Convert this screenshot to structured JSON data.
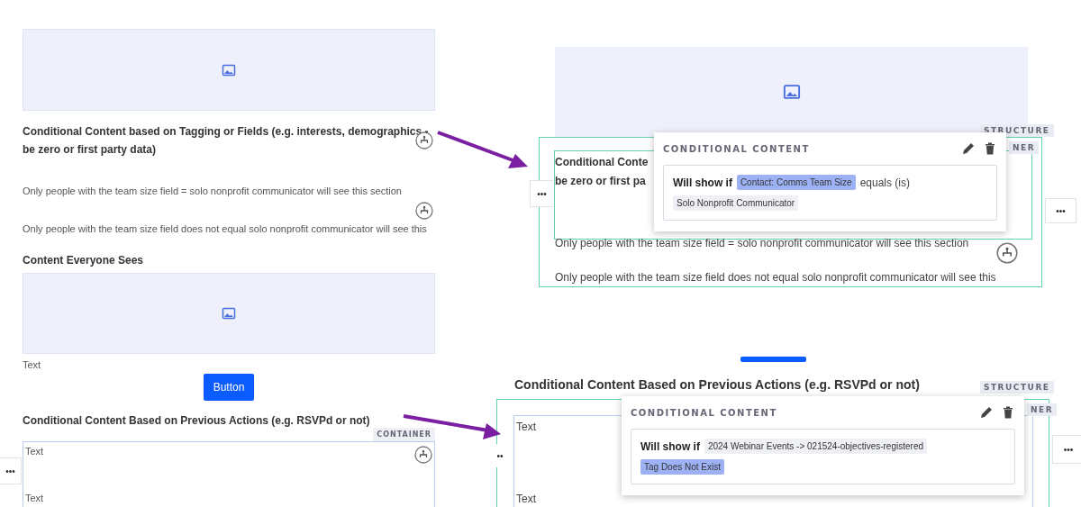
{
  "left_editor": {
    "tagging_heading_lines": [
      "Conditional Content based on Tagging or Fields (e.g. interests, demographics -",
      "be zero or first party data)"
    ],
    "field_equals_text": "Only people with the team size field = solo nonprofit communicator will see this section",
    "field_not_equal_text": "Only people with the team size field does not equal solo nonprofit communicator will see this",
    "everyone_heading": "Content Everyone Sees",
    "text_block": "Text",
    "button_label": "Button",
    "actions_heading": "Conditional Content Based on Previous Actions (e.g. RSVPd or not)",
    "container_tag": "CONTAINER",
    "container_texts": [
      "Text",
      "Text"
    ],
    "more_button": "•••"
  },
  "fields_popup_view": {
    "structure_tag": "STRUCTURE",
    "container_tag_part": "NER",
    "heading_parts": [
      "Conditional Conte",
      "be zero or first pa"
    ],
    "field_equals_text": "Only people with the team size field = solo nonprofit communicator will see this section",
    "field_not_equal_text": "Only people with the team size field does not equal solo nonprofit communicator will see this",
    "more_buttons": [
      "•••",
      "•••"
    ],
    "popup": {
      "title": "CONDITIONAL CONTENT",
      "lead": "Will show if",
      "condition": "Contact: Comms Team Size",
      "operator": "equals (is)",
      "value": "Solo Nonprofit Communicator"
    }
  },
  "actions_popup_view": {
    "heading": "Conditional Content Based on Previous Actions (e.g. RSVPd or not)",
    "structure_tag": "STRUCTURE",
    "container_tag_part": "NER",
    "texts": [
      "Text",
      "Text"
    ],
    "more_buttons": [
      "••",
      "•••"
    ],
    "popup": {
      "title": "CONDITIONAL CONTENT",
      "lead": "Will show if",
      "condition": "2024 Webinar Events -> 021524-objectives-registered",
      "value": "Tag Does Not Exist"
    }
  }
}
